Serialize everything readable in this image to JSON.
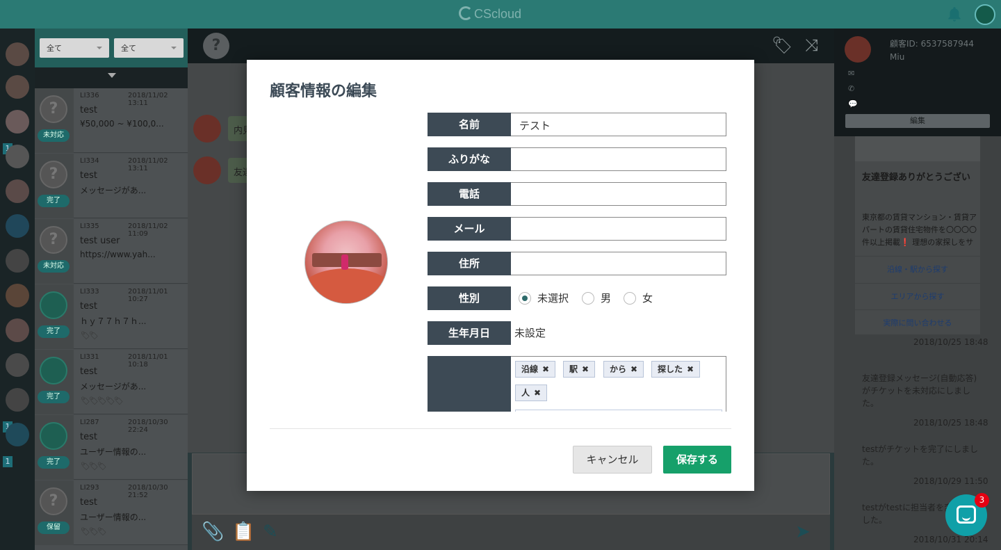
{
  "app": {
    "logo_text": "CScloud",
    "help_badge": "3"
  },
  "filters": {
    "status": "全て",
    "assignee": "全て"
  },
  "tickets": [
    {
      "id": "LI336",
      "date": "2018/11/02 13:11",
      "name": "test",
      "message": "¥50,000 ~ ¥100,0...",
      "status": "未対応",
      "avatar": "?",
      "tags": ""
    },
    {
      "id": "LI334",
      "date": "2018/11/02 13:11",
      "name": "test",
      "message": "メッセージがあ...",
      "status": "完了",
      "avatar": "?",
      "tags": ""
    },
    {
      "id": "LI335",
      "date": "2018/11/02 11:09",
      "name": "test user",
      "message": "https://www.yah...",
      "status": "未対応",
      "avatar": "?",
      "tags": ""
    },
    {
      "id": "LI333",
      "date": "2018/11/01 10:27",
      "name": "test",
      "message": "ｈｙ７７ｈ７ｈ...",
      "status": "完了",
      "avatar": "",
      "tags": "🏷🏷"
    },
    {
      "id": "LI331",
      "date": "2018/11/01 10:18",
      "name": "test",
      "message": "メッセージがあ...",
      "status": "完了",
      "avatar": "",
      "tags": "🏷🏷🏷🏷🏷"
    },
    {
      "id": "LI287",
      "date": "2018/10/30 22:24",
      "name": "test",
      "message": "ユーザー情報の...",
      "status": "完了",
      "avatar": "",
      "tags": "🏷🏷🏷"
    },
    {
      "id": "LI293",
      "date": "2018/10/30 21:52",
      "name": "test",
      "message": "ユーザー情報の...",
      "status": "保留",
      "avatar": "?",
      "tags": "🏷🏷🏷"
    }
  ],
  "nav_badges": [
    "1",
    "1",
    "1"
  ],
  "chat": {
    "header_avatar": "?",
    "messages": [
      "内見",
      "友達"
    ]
  },
  "customer": {
    "id_label": "顧客ID: 6537587944",
    "name": "Miu",
    "edit_label": "編集",
    "card_title": "友達登録ありがとうござい",
    "card_body": "東京都の賃貸マンション・賃貸アパートの賃貸住宅物件を〇〇〇〇件以上掲載❗️ 理想の家探しをサポートします",
    "card_links": [
      "沿線・駅から探す",
      "エリアから探す",
      "実際に問い合わせる"
    ],
    "log": [
      {
        "time": "2018/10/25 18:48",
        "text": ""
      },
      {
        "time": "2018/10/25 18:48",
        "text": "友達登録メッセージ(自動応答)がチケットを未対応にしました。"
      },
      {
        "time": "2018/10/29 11:50",
        "text": "testがチケットを完了にしました。"
      },
      {
        "time": "2018/10/31 20:14",
        "text": "testがtestに担当者を変更しました。"
      }
    ]
  },
  "modal": {
    "title": "顧客情報の編集",
    "fields": {
      "name_label": "名前",
      "name_value": "テスト",
      "kana_label": "ふりがな",
      "kana_value": "",
      "phone_label": "電話",
      "phone_value": "",
      "mail_label": "メール",
      "mail_value": "",
      "address_label": "住所",
      "address_value": "",
      "gender_label": "性別",
      "gender_options": [
        "未選択",
        "男",
        "女"
      ],
      "gender_selected": "未選択",
      "birthday_label": "生年月日",
      "birthday_value": "未設定",
      "tags": [
        "沿線",
        "駅",
        "から",
        "探した",
        "人"
      ]
    },
    "cancel_label": "キャンセル",
    "save_label": "保存する"
  },
  "colors": {
    "accent": "#2b7a74",
    "save": "#16a06a",
    "label_bg": "#3d4a55",
    "badge": "#e60012"
  }
}
